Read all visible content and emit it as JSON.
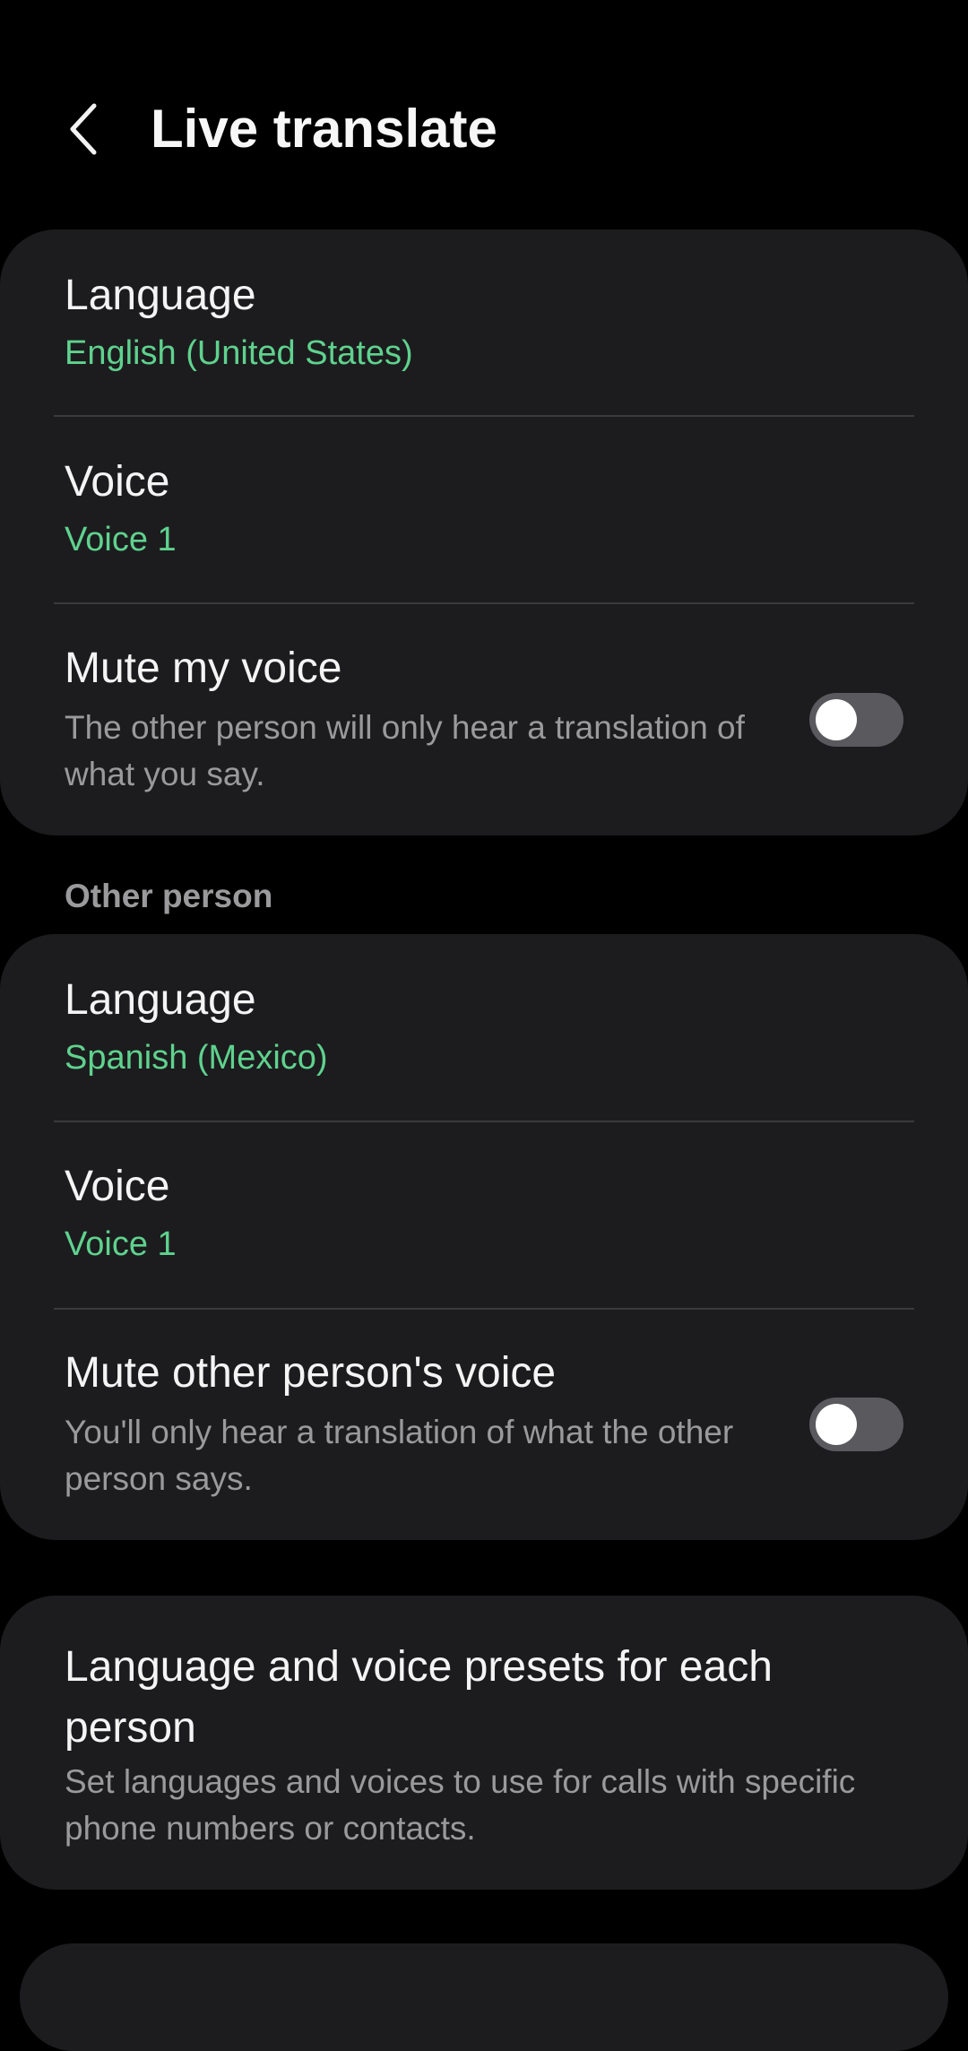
{
  "colors": {
    "background": "#000000",
    "card": "#1c1c1e",
    "accent_value": "#5fd28e",
    "secondary_text": "#9a9a9c",
    "toggle_off_track": "#5a5a5e"
  },
  "header": {
    "back_icon": "chevron-left-icon",
    "title": "Live translate"
  },
  "me": {
    "language": {
      "label": "Language",
      "value": "English (United States)"
    },
    "voice": {
      "label": "Voice",
      "value": "Voice 1"
    },
    "mute": {
      "label": "Mute my voice",
      "description": "The other person will only hear a translation of what you say.",
      "enabled": false
    }
  },
  "other_person": {
    "section_title": "Other person",
    "language": {
      "label": "Language",
      "value": "Spanish (Mexico)"
    },
    "voice": {
      "label": "Voice",
      "value": "Voice 1"
    },
    "mute": {
      "label": "Mute other person's voice",
      "description": "You'll only hear a translation of what the other person says.",
      "enabled": false
    }
  },
  "presets": {
    "title": "Language and voice presets for each person",
    "description": "Set languages and voices to use for calls with specific phone numbers or contacts."
  }
}
